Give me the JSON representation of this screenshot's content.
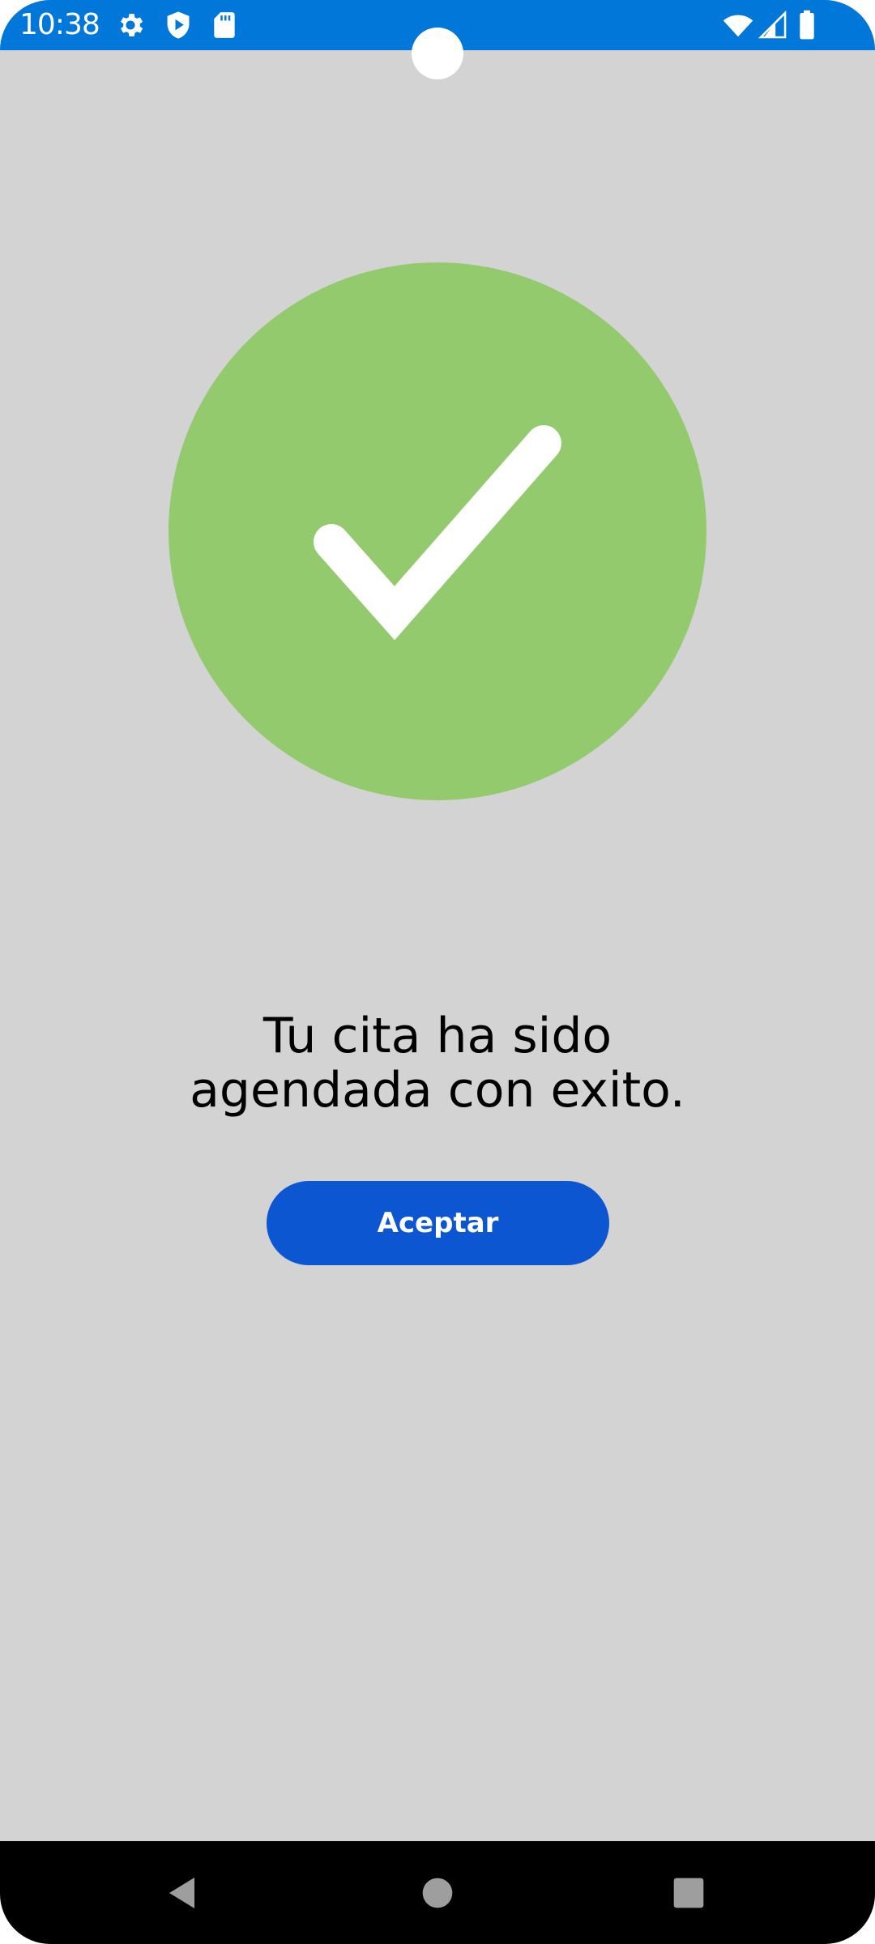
{
  "status_bar": {
    "time": "10:38",
    "background_color": "#0077d9",
    "left_icons": [
      "settings-gear-icon",
      "shield-play-icon",
      "sd-card-icon"
    ],
    "right_icons": [
      "wifi-icon",
      "cell-signal-icon",
      "battery-icon"
    ]
  },
  "main": {
    "success_icon": "checkmark-icon",
    "success_color": "#92ca6d",
    "message": "Tu cita ha sido\nagendada con exito.",
    "accept_button_label": "Aceptar",
    "accept_button_color": "#0d56d2"
  },
  "nav_bar": {
    "buttons": [
      "back-icon",
      "home-icon",
      "recents-icon"
    ]
  }
}
